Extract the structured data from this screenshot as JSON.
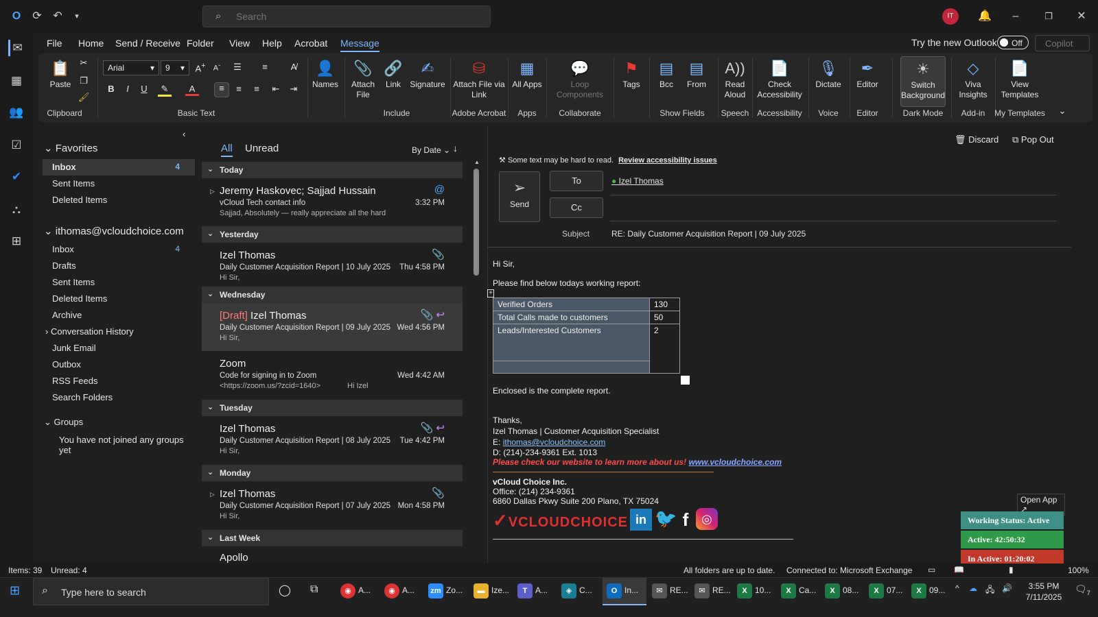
{
  "titlebar": {
    "search_placeholder": "Search",
    "avatar_initials": "IT"
  },
  "menu": {
    "tabs": [
      "File",
      "Home",
      "Send / Receive",
      "Folder",
      "View",
      "Help",
      "Acrobat",
      "Message"
    ],
    "active": "Message",
    "try_new": "Try the new Outlook",
    "toggle_state": "Off",
    "copilot": "Copilot"
  },
  "ribbon": {
    "paste": "Paste",
    "font_name": "Arial",
    "font_size": "9",
    "names": "Names",
    "attach_file": "Attach File",
    "link": "Link",
    "signature": "Signature",
    "attach_via_link": "Attach File via Link",
    "all_apps": "All Apps",
    "loop": "Loop Components",
    "tags": "Tags",
    "bcc": "Bcc",
    "from": "From",
    "read_aloud": "Read Aloud",
    "check_accessibility": "Check Accessibility",
    "dictate": "Dictate",
    "editor": "Editor",
    "switch_bg": "Switch Background",
    "viva": "Viva Insights",
    "view_templates": "View Templates",
    "groups": {
      "clipboard": "Clipboard",
      "basic_text": "Basic Text",
      "include": "Include",
      "adobe": "Adobe Acrobat",
      "apps": "Apps",
      "collaborate": "Collaborate",
      "show_fields": "Show Fields",
      "speech": "Speech",
      "accessibility": "Accessibility",
      "voice": "Voice",
      "editor": "Editor",
      "dark_mode": "Dark Mode",
      "addin": "Add-in",
      "my_templates": "My Templates"
    }
  },
  "folders": {
    "favorites_label": "Favorites",
    "favorites": [
      {
        "label": "Inbox",
        "count": "4"
      },
      {
        "label": "Sent Items",
        "count": ""
      },
      {
        "label": "Deleted Items",
        "count": ""
      }
    ],
    "account": "ithomas@vcloudchoice.com",
    "account_items": [
      {
        "label": "Inbox",
        "count": "4"
      },
      {
        "label": "Drafts",
        "count": ""
      },
      {
        "label": "Sent Items",
        "count": ""
      },
      {
        "label": "Deleted Items",
        "count": ""
      },
      {
        "label": "Archive",
        "count": ""
      },
      {
        "label": "Conversation History",
        "count": ""
      },
      {
        "label": "Junk Email",
        "count": ""
      },
      {
        "label": "Outbox",
        "count": ""
      },
      {
        "label": "RSS Feeds",
        "count": ""
      },
      {
        "label": "Search Folders",
        "count": ""
      }
    ],
    "groups_label": "Groups",
    "groups_note": "You have not joined any groups yet"
  },
  "list": {
    "tab_all": "All",
    "tab_unread": "Unread",
    "sort": "By Date",
    "groups": {
      "today": "Today",
      "yesterday": "Yesterday",
      "wednesday": "Wednesday",
      "tuesday": "Tuesday",
      "monday": "Monday",
      "last_week": "Last Week"
    },
    "messages": [
      {
        "sender": "Jeremy Haskovec;  Sajjad Hussain",
        "subject": "vCloud Tech contact info",
        "preview": "Sajjad,     Absolutely — really appreciate all the hard",
        "time": "3:32 PM"
      },
      {
        "sender": "Izel Thomas",
        "subject": "Daily Customer Acquisition Report | 10 July 2025",
        "preview": "Hi Sir,",
        "time": "Thu 4:58 PM"
      },
      {
        "draft": "[Draft]",
        "sender": "Izel Thomas",
        "subject": "Daily Customer Acquisition Report | 09 July 2025",
        "preview": "Hi Sir,",
        "time": "Wed 4:56 PM"
      },
      {
        "sender": "Zoom",
        "subject": "Code for signing in to Zoom",
        "preview": "<https://zoom.us/?zcid=1640>",
        "preview2": "Hi Izel",
        "time": "Wed 4:42 AM"
      },
      {
        "sender": "Izel Thomas",
        "subject": "Daily Customer Acquisition Report | 08 July 2025",
        "preview": "Hi Sir,",
        "time": "Tue 4:42 PM"
      },
      {
        "sender": "Izel Thomas",
        "subject": "Daily Customer Acquisition Report | 07 July 2025",
        "preview": "Hi Sir,",
        "time": "Mon 4:58 PM"
      },
      {
        "sender": "Apollo",
        "subject": "",
        "preview": "",
        "time": ""
      }
    ]
  },
  "compose": {
    "discard": "Discard",
    "pop_out": "Pop Out",
    "accessibility_note": "Some text may be hard to read.",
    "review_link": "Review accessibility issues",
    "send": "Send",
    "to_label": "To",
    "cc_label": "Cc",
    "to_value": "Izel Thomas",
    "subject_label": "Subject",
    "subject_value": "RE: Daily Customer Acquisition Report | 09 July 2025"
  },
  "email_body": {
    "greeting": "Hi Sir,",
    "intro": "Please find below todays working report:",
    "rows": [
      {
        "label": "Verified Orders",
        "value": "130"
      },
      {
        "label": "Total Calls made to customers",
        "value": "50"
      },
      {
        "label": "Leads/Interested Customers",
        "value": "2"
      }
    ],
    "enclosed": "Enclosed is the complete report.",
    "thanks": "Thanks,",
    "sig_name": "Izel Thomas | Customer Acquisition Specialist",
    "sig_email_label": "E:",
    "sig_email": "ithomas@vcloudchoice.com",
    "sig_phone": "D: (214)-234-9361 Ext. 1013",
    "sig_cta": "Please check our website to learn more about us!",
    "sig_site": "www.vcloudchoice.com",
    "company": "vCloud Choice Inc.",
    "office": "Office: (214) 234-9361",
    "address": "6860 Dallas Pkwy Suite 200 Plano, TX 75024",
    "logo_text": "VCLOUDCHOICE"
  },
  "widget": {
    "open_app": "Open App ↗",
    "status": "Working Status: Active",
    "active": "Active: 42:50:32",
    "inactive": "In Active: 01:20:02",
    "colors": {
      "status": "#3f8f86",
      "active": "#2f9a4a",
      "inactive": "#c0392b"
    }
  },
  "statusbar": {
    "items": "Items: 39",
    "unread": "Unread: 4",
    "sync": "All folders are up to date.",
    "connected": "Connected to: Microsoft Exchange",
    "zoom": "100%"
  },
  "taskbar": {
    "search": "Type here to search",
    "apps": [
      "A...",
      "A...",
      "Zo...",
      "Ize...",
      "A...",
      "C...",
      "In...",
      "RE...",
      "RE...",
      "10...",
      "Ca...",
      "08...",
      "07...",
      "09..."
    ],
    "time": "3:55 PM",
    "date": "7/11/2025",
    "notif": "7"
  }
}
